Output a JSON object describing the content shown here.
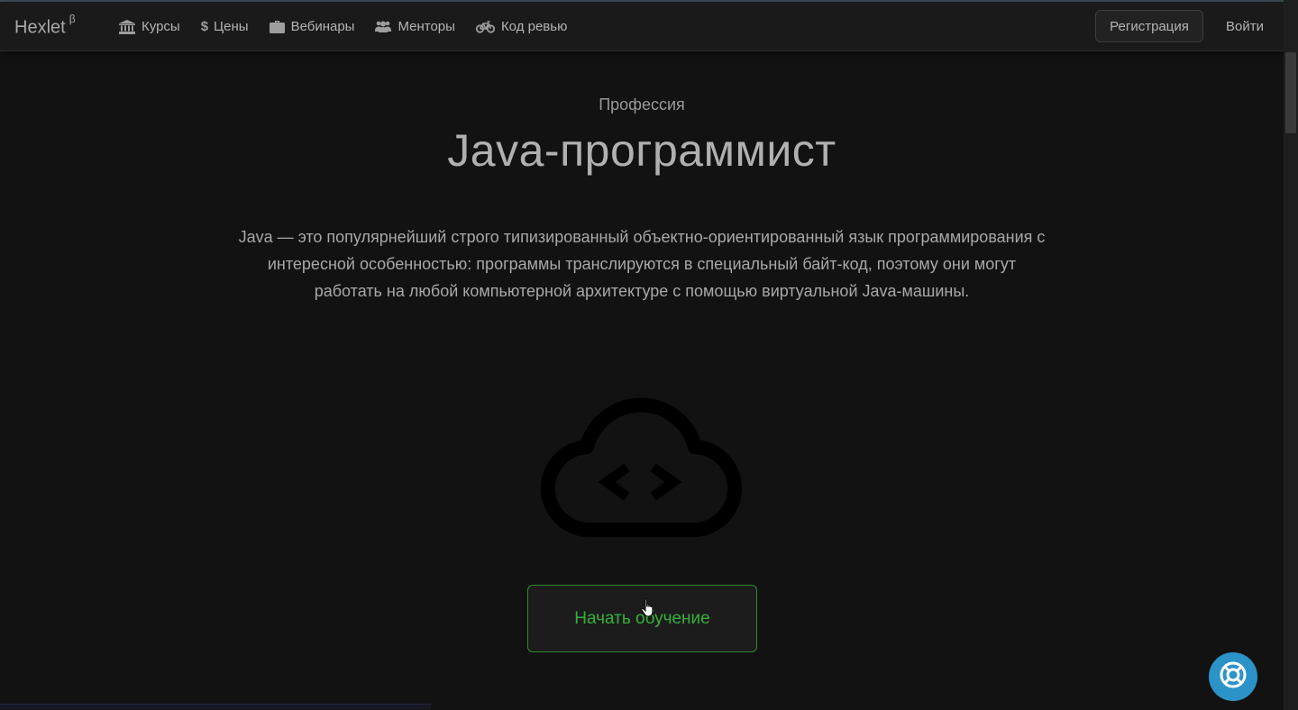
{
  "navbar": {
    "brand": "Hexlet",
    "brand_sup": "β",
    "links": [
      {
        "label": "Курсы",
        "icon": "university-icon"
      },
      {
        "label": "Цены",
        "icon": "dollar-icon"
      },
      {
        "label": "Вебинары",
        "icon": "briefcase-icon"
      },
      {
        "label": "Менторы",
        "icon": "users-icon"
      },
      {
        "label": "Код ревью",
        "icon": "bicycle-icon"
      }
    ],
    "register_label": "Регистрация",
    "login_label": "Войти"
  },
  "hero": {
    "eyebrow": "Профессия",
    "title": "Java-программист",
    "description": "Java — это популярнейший строго типизированный объектно-ориентированный язык программирования с интересной особенностью: программы транслируются в специальный байт-код, поэтому они могут работать на любой компьютерной архитектуре с помощью виртуальной Java-машины.",
    "icon": "cloud-code-icon",
    "cta_label": "Начать обучение"
  },
  "help": {
    "icon": "lifebuoy-icon"
  },
  "colors": {
    "background": "#121212",
    "accent_green": "#36b03a",
    "help_blue": "#2b93c8"
  }
}
